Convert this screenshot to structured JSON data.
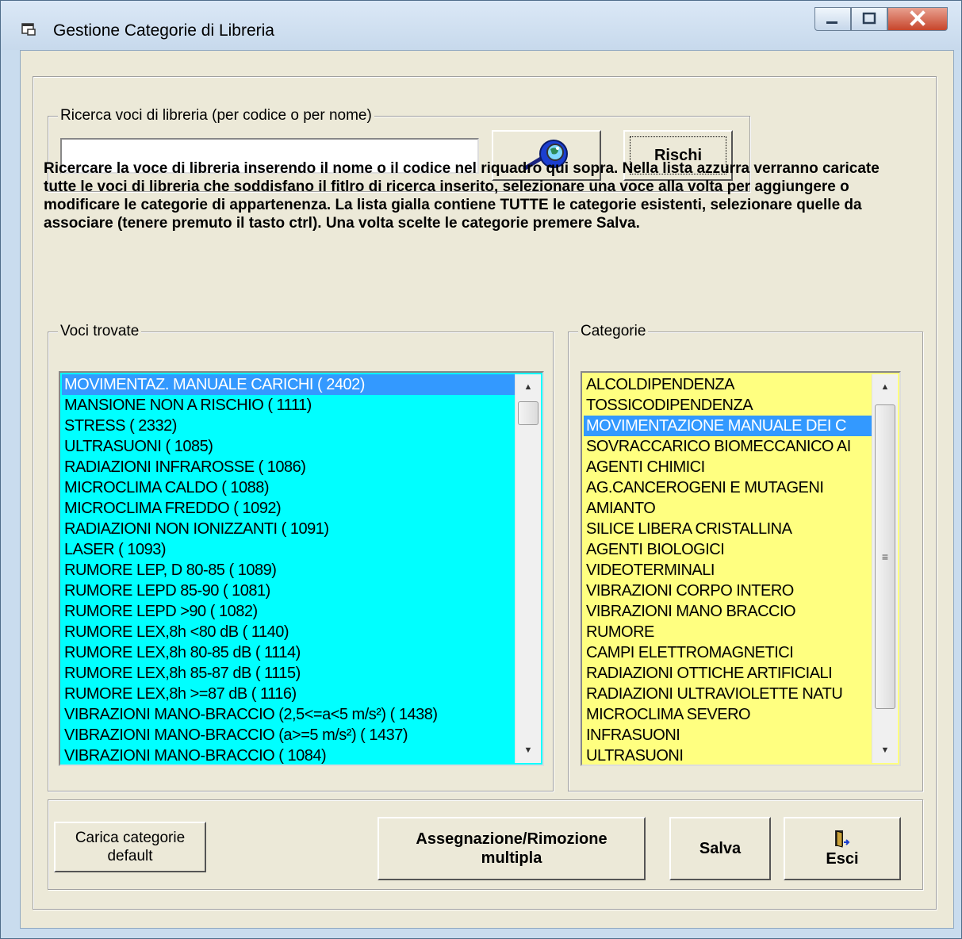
{
  "window": {
    "title": "Gestione Categorie di Libreria"
  },
  "search": {
    "group_label": "Ricerca voci di libreria (per codice o per nome)",
    "value": "",
    "search_button_icon": "search-globe-icon",
    "rischi_label": "Rischi"
  },
  "instructions": "Ricercare la voce di libreria inserendo il nome o il codice nel riquadro qui sopra. Nella lista azzurra verranno caricate tutte le voci di libreria che soddisfano il fitlro di ricerca inserito, selezionare una voce alla volta per aggiungere o modificare le categorie di appartenenza. La lista gialla contiene TUTTE le categorie esistenti, selezionare quelle da associare (tenere premuto il tasto ctrl). Una volta scelte le categorie premere Salva.",
  "voci": {
    "group_label": "Voci trovate",
    "background": "#00ffff",
    "items": [
      "MOVIMENTAZ. MANUALE CARICHI ( 2402)",
      "MANSIONE NON A RISCHIO ( 1111)",
      "STRESS ( 2332)",
      "ULTRASUONI ( 1085)",
      "RADIAZIONI INFRAROSSE ( 1086)",
      "MICROCLIMA CALDO ( 1088)",
      "MICROCLIMA FREDDO ( 1092)",
      "RADIAZIONI NON IONIZZANTI ( 1091)",
      "LASER ( 1093)",
      "RUMORE LEP, D  80-85 ( 1089)",
      "RUMORE LEPD 85-90 ( 1081)",
      "RUMORE LEPD >90 ( 1082)",
      "RUMORE LEX,8h <80 dB ( 1140)",
      "RUMORE LEX,8h 80-85 dB ( 1114)",
      "RUMORE LEX,8h 85-87 dB ( 1115)",
      "RUMORE LEX,8h >=87 dB ( 1116)",
      "VIBRAZIONI MANO-BRACCIO (2,5<=a<5 m/s²) ( 1438)",
      "VIBRAZIONI MANO-BRACCIO (a>=5 m/s²) ( 1437)",
      "VIBRAZIONI MANO-BRACCIO ( 1084)"
    ],
    "selected_index": 0
  },
  "categorie": {
    "group_label": "Categorie",
    "background": "#ffff80",
    "items": [
      "ALCOLDIPENDENZA",
      "TOSSICODIPENDENZA",
      "MOVIMENTAZIONE MANUALE DEI C",
      "SOVRACCARICO BIOMECCANICO AI",
      "AGENTI CHIMICI",
      "AG.CANCEROGENI E MUTAGENI",
      "AMIANTO",
      "SILICE LIBERA CRISTALLINA",
      "AGENTI BIOLOGICI",
      "VIDEOTERMINALI",
      "VIBRAZIONI CORPO INTERO",
      "VIBRAZIONI MANO BRACCIO",
      "RUMORE",
      "CAMPI ELETTROMAGNETICI",
      "RADIAZIONI OTTICHE ARTIFICIALI",
      "RADIAZIONI ULTRAVIOLETTE NATU",
      "MICROCLIMA SEVERO",
      "INFRASUONI",
      "ULTRASUONI"
    ],
    "selected_index": 2
  },
  "buttons": {
    "carica_line1": "Carica categorie",
    "carica_line2": "default",
    "assegnazione_line1": "Assegnazione/Rimozione",
    "assegnazione_line2": "multipla",
    "salva": "Salva",
    "esci": "Esci"
  },
  "colors": {
    "selection": "#3399ff",
    "dialog_bg": "#ece9d8"
  }
}
